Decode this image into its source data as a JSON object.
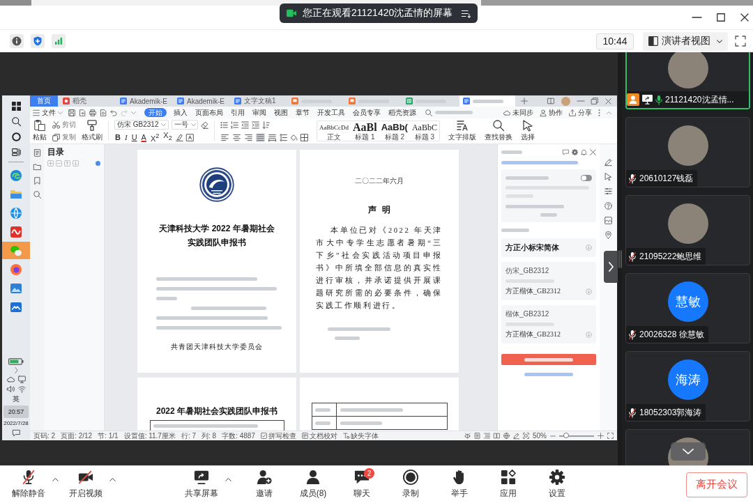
{
  "meeting_banner": {
    "text": "您正在观看21121420沈孟情的屏幕"
  },
  "top_bar": {
    "time": "10:44",
    "view_mode": "演讲者视图"
  },
  "shared_screen": {
    "taskbar": {
      "apps": [
        {
          "kind": "edge",
          "flashing": false
        },
        {
          "kind": "folder",
          "flashing": false
        },
        {
          "kind": "browser",
          "flashing": false
        },
        {
          "kind": "wps",
          "flashing": false
        },
        {
          "kind": "wechat",
          "flashing": true
        },
        {
          "kind": "firefox",
          "flashing": false
        },
        {
          "kind": "photos",
          "flashing": false
        },
        {
          "kind": "whiteboard",
          "flashing": false
        }
      ],
      "input_method": "英",
      "time": "20:57",
      "date": "2022/7/28"
    },
    "doc_tabs": [
      {
        "kind": "home",
        "label": "首页",
        "selected": false
      },
      {
        "kind": "docer",
        "label": "稻壳",
        "selected": false
      },
      {
        "kind": "writer",
        "label": "Akademik-E",
        "selected": false
      },
      {
        "kind": "writer",
        "label": "Akademik-E",
        "selected": false
      },
      {
        "kind": "writer",
        "label": "文字文稿1",
        "selected": false
      },
      {
        "kind": "presentation",
        "selected": false
      },
      {
        "kind": "presentation",
        "selected": false
      },
      {
        "kind": "sheet",
        "selected": false
      },
      {
        "kind": "writer",
        "selected": true
      }
    ],
    "menu": {
      "file": "文件",
      "ribbon_tabs": [
        {
          "label": "开始",
          "selected": true
        },
        {
          "label": "插入",
          "selected": false
        },
        {
          "label": "页面布局",
          "selected": false
        },
        {
          "label": "引用",
          "selected": false
        },
        {
          "label": "审阅",
          "selected": false
        },
        {
          "label": "视图",
          "selected": false
        },
        {
          "label": "章节",
          "selected": false
        },
        {
          "label": "开发工具",
          "selected": false
        },
        {
          "label": "会员专享",
          "selected": false
        },
        {
          "label": "稻壳资源",
          "selected": false
        }
      ],
      "actions": [
        {
          "kind": "sync",
          "label": "未同步"
        },
        {
          "kind": "collaborate",
          "label": "协作"
        },
        {
          "kind": "share",
          "label": "分享"
        }
      ]
    },
    "ribbon": {
      "paste": "粘贴",
      "cut": "剪切",
      "copy": "复制",
      "format_painter": "格式刷",
      "font": "仿宋 GB2312",
      "size": "一号",
      "format_buttons": [
        {
          "kind": "bold",
          "label": "B"
        },
        {
          "kind": "italic",
          "label": "I"
        },
        {
          "kind": "underline",
          "label": "U"
        },
        {
          "kind": "color",
          "label": "A"
        },
        {
          "kind": "superscript",
          "label": "X$^{2}$"
        },
        {
          "kind": "subscript",
          "label": "X$_{2}$"
        }
      ],
      "align_buttons": [
        {
          "kind": "left",
          "selected": false
        },
        {
          "kind": "center",
          "selected": false
        },
        {
          "kind": "right",
          "selected": false
        },
        {
          "kind": "justify",
          "selected": true
        },
        {
          "kind": "distributed",
          "selected": false
        }
      ],
      "styles": [
        {
          "kind": "body",
          "preview": "AaBbCcDd",
          "label": "正文"
        },
        {
          "kind": "heading1",
          "preview": "AaBl",
          "label": "标题 1"
        },
        {
          "kind": "heading2",
          "preview": "AaBb(",
          "label": "标题 2"
        },
        {
          "kind": "heading3",
          "preview": "AaBbC",
          "label": "标题 3"
        }
      ],
      "tools": [
        {
          "kind": "layout",
          "label": "文字排版"
        },
        {
          "kind": "find",
          "label": "查找替换"
        },
        {
          "kind": "select",
          "label": "选择"
        }
      ]
    },
    "nav_pane": {
      "title": "目录"
    },
    "pages": [
      {
        "kind": "cover",
        "title_lines": [
          "天津科技大学 2022 年暑期社会",
          "实践团队申报书"
        ],
        "issuer": "共青团天津科技大学委员会"
      },
      {
        "kind": "statement",
        "date": "二〇二二年六月",
        "heading": "声明",
        "body": "本单位已对《2022 年天津市大中专学生志愿者暑期“三下乡”社会实践活动项目申报书》中所填全部信息的真实性进行审核，并承诺提供开展课题研究所需的必要条件，确保实践工作顺利进行。"
      },
      {
        "kind": "form",
        "title": "2022 年暑期社会实践团队申报书"
      },
      {
        "kind": "table"
      }
    ],
    "font_pane": {
      "auto_show_missing": {
        "on": false
      },
      "fonts": [
        {
          "kind": "available",
          "name": "方正小标宋简体"
        },
        {
          "kind": "substitute",
          "missing": "仿宋_GB2312",
          "replacement": "方正楷体_GB2312"
        },
        {
          "kind": "substitute",
          "missing": "楷体_GB2312",
          "replacement": "方正楷体_GB2312"
        }
      ]
    },
    "status_bar": {
      "items": [
        "页码: 2",
        "页面: 2/12",
        "节: 1/1",
        "设置值: 11.7厘米",
        "行: 7",
        "列: 8",
        "字数: 4887"
      ],
      "buttons": [
        {
          "kind": "spellcheck",
          "label": "拼写检查"
        },
        {
          "kind": "proofread",
          "label": "文档校对"
        },
        {
          "kind": "missing_fonts",
          "label": "缺失字体"
        }
      ],
      "zoom": "50%",
      "zoom_slider": {
        "level": 0.2
      }
    }
  },
  "participants": [
    {
      "kind": "photo",
      "name": "21121420沈孟情...",
      "host": true,
      "sharing": true,
      "mic_on": true,
      "speaking": true
    },
    {
      "kind": "photo",
      "name": "20610127钱磊",
      "host": false,
      "sharing": false,
      "mic_on": false,
      "speaking": false
    },
    {
      "kind": "photo",
      "name": "21095222鲍思维",
      "host": false,
      "sharing": false,
      "mic_on": false,
      "speaking": false
    },
    {
      "kind": "initials",
      "initials": "慧敏",
      "name": "20026328 徐慧敏",
      "host": false,
      "sharing": false,
      "mic_on": false,
      "speaking": false
    },
    {
      "kind": "initials",
      "initials": "海涛",
      "name": "18052303郭海涛",
      "host": false,
      "sharing": false,
      "mic_on": false,
      "speaking": false
    },
    {
      "kind": "photo",
      "speaking": false
    }
  ],
  "toolbar": {
    "left": [
      {
        "kind": "mic_off",
        "label": "解除静音",
        "menu": true
      },
      {
        "kind": "camera_off",
        "label": "开启视频",
        "menu": true
      }
    ],
    "center": [
      {
        "kind": "share_screen",
        "label": "共享屏幕",
        "menu": true
      },
      {
        "kind": "invite",
        "label": "邀请",
        "menu": false
      },
      {
        "kind": "members",
        "label": "成员(8)",
        "menu": false
      },
      {
        "kind": "chat",
        "label": "聊天",
        "menu": false,
        "badge": "2"
      },
      {
        "kind": "record",
        "label": "录制",
        "menu": false
      },
      {
        "kind": "raise_hand",
        "label": "举手",
        "menu": false
      },
      {
        "kind": "apps",
        "label": "应用",
        "menu": false
      },
      {
        "kind": "settings",
        "label": "设置",
        "menu": false
      }
    ],
    "leave": "离开会议"
  }
}
